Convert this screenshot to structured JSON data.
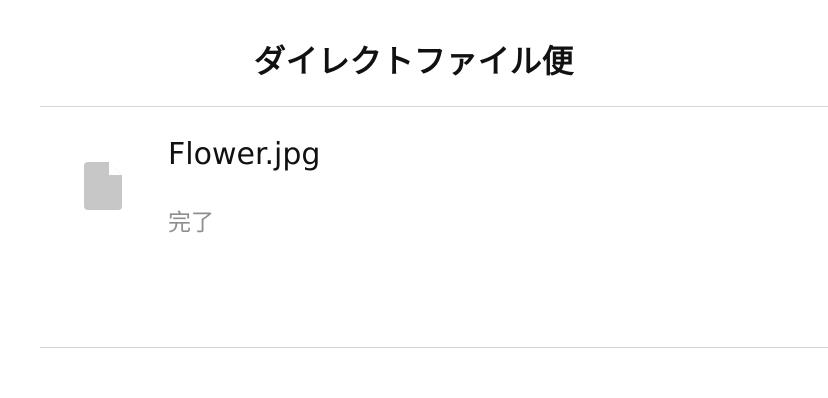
{
  "header": {
    "title": "ダイレクトファイル便"
  },
  "files": [
    {
      "name": "Flower.jpg",
      "status": "完了",
      "icon": "document-icon"
    }
  ],
  "colors": {
    "icon": "#c7c7c7",
    "status_text": "#8e8e8e",
    "divider": "#d6d6d6"
  }
}
